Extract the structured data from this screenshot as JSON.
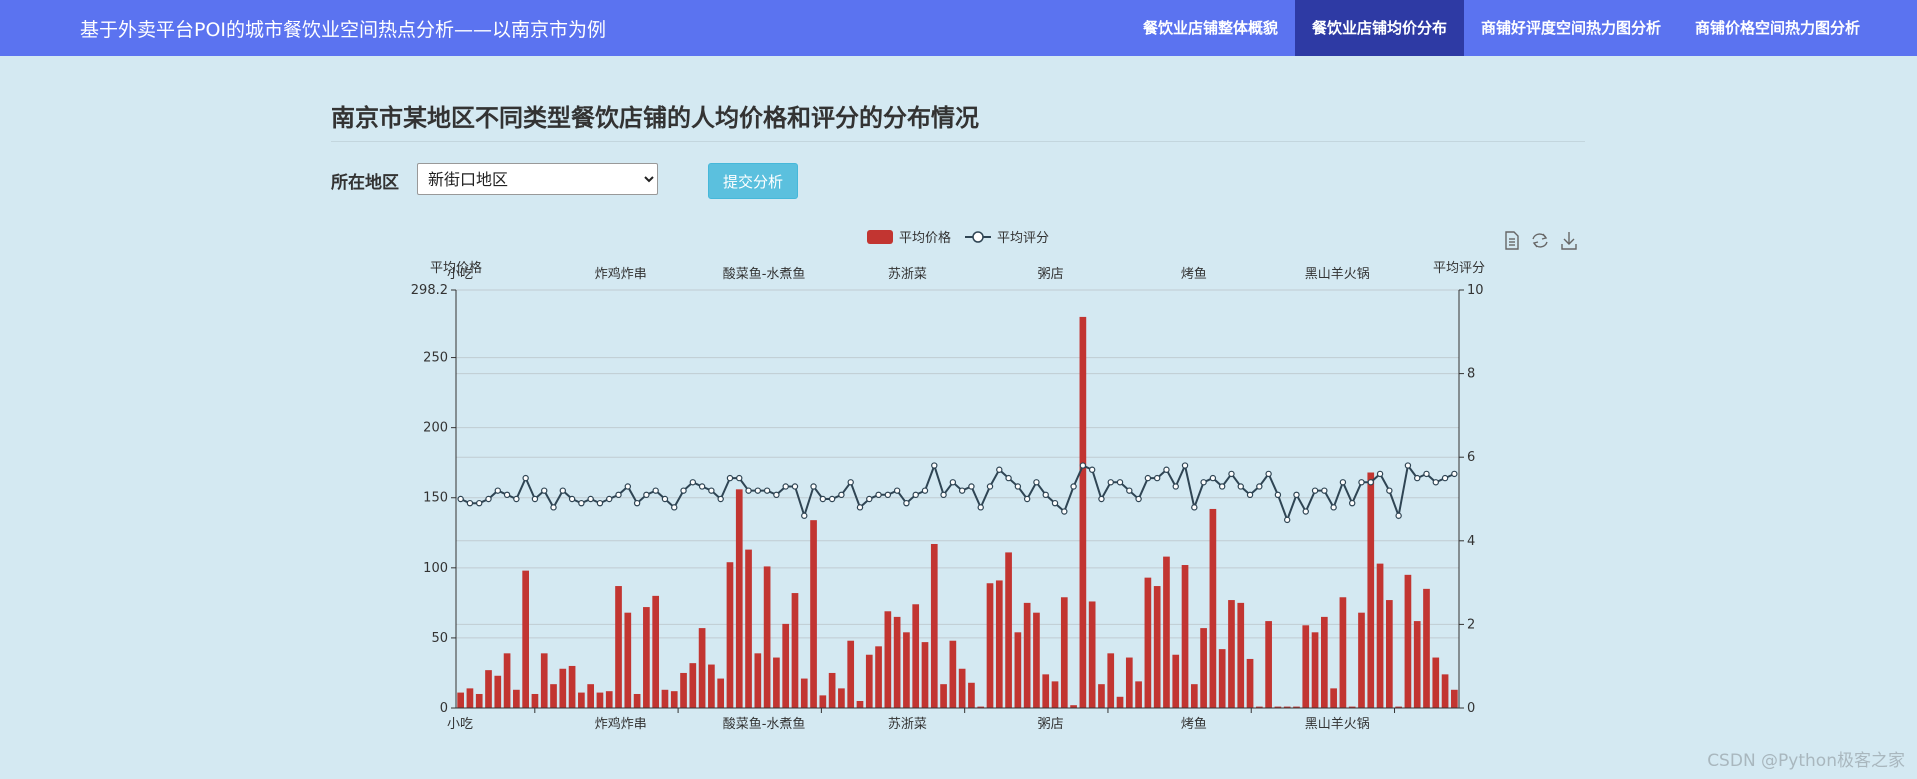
{
  "navbar": {
    "brand": "基于外卖平台POI的城市餐饮业空间热点分析——以南京市为例",
    "items": [
      {
        "label": "餐饮业店铺整体概貌",
        "active": false
      },
      {
        "label": "餐饮业店铺均价分布",
        "active": true
      },
      {
        "label": "商铺好评度空间热力图分析",
        "active": false
      },
      {
        "label": "商铺价格空间热力图分析",
        "active": false
      }
    ]
  },
  "page_title": "南京市某地区不同类型餐饮店铺的人均价格和评分的分布情况",
  "form": {
    "region_label": "所在地区",
    "region_value": "新街口地区",
    "submit_label": "提交分析"
  },
  "toolbox": [
    "data-view-icon",
    "restore-icon",
    "save-image-icon"
  ],
  "watermark": "CSDN @Python极客之家",
  "chart_data": {
    "type": "bar+line",
    "legend": [
      "平均价格",
      "平均评分"
    ],
    "legend_position": "top-center",
    "grid": true,
    "colors": {
      "bar": "#c23531",
      "line": "#2f4554"
    },
    "y_left": {
      "label": "平均价格",
      "min": 0,
      "max": 298.2,
      "ticks": [
        "0",
        "50",
        "100",
        "150",
        "200",
        "250",
        "298.2"
      ]
    },
    "y_right": {
      "label": "平均评分",
      "min": 0,
      "max": 10,
      "ticks": [
        "0",
        "2",
        "4",
        "6",
        "8",
        "10"
      ]
    },
    "x_tick_labels": [
      "小吃",
      "炸鸡炸串",
      "酸菜鱼-水煮鱼",
      "苏浙菜",
      "粥店",
      "烤鱼",
      "黑山羊火锅"
    ],
    "series": [
      {
        "name": "平均价格",
        "type": "bar",
        "values": [
          11,
          14,
          10,
          27,
          23,
          39,
          13,
          98,
          10,
          39,
          17,
          28,
          30,
          11,
          17,
          11,
          12,
          87,
          68,
          10,
          72,
          80,
          13,
          12,
          25,
          32,
          57,
          31,
          21,
          104,
          156,
          113,
          39,
          101,
          36,
          60,
          82,
          21,
          134,
          9,
          25,
          14,
          48,
          5,
          38,
          44,
          69,
          65,
          54,
          74,
          47,
          117,
          17,
          48,
          28,
          18,
          1,
          89,
          91,
          111,
          54,
          75,
          68,
          24,
          19,
          79,
          2,
          279,
          76,
          17,
          39,
          8,
          36,
          19,
          93,
          87,
          108,
          38,
          102,
          17,
          57,
          142,
          42,
          77,
          75,
          35,
          1,
          62,
          1,
          1,
          1,
          59,
          54,
          65,
          14,
          79,
          1,
          68,
          168,
          103,
          77,
          1,
          95,
          62,
          85,
          36,
          24,
          13
        ]
      },
      {
        "name": "平均评分",
        "type": "line",
        "values": [
          5.0,
          4.9,
          4.9,
          5.0,
          5.2,
          5.1,
          5.0,
          5.5,
          5.0,
          5.2,
          4.8,
          5.2,
          5.0,
          4.9,
          5.0,
          4.9,
          5.0,
          5.1,
          5.3,
          4.9,
          5.1,
          5.2,
          5.0,
          4.8,
          5.2,
          5.4,
          5.3,
          5.2,
          5.0,
          5.5,
          5.5,
          5.2,
          5.2,
          5.2,
          5.1,
          5.3,
          5.3,
          4.6,
          5.3,
          5.0,
          5.0,
          5.1,
          5.4,
          4.8,
          5.0,
          5.1,
          5.1,
          5.2,
          4.9,
          5.1,
          5.2,
          5.8,
          5.1,
          5.4,
          5.2,
          5.3,
          4.8,
          5.3,
          5.7,
          5.5,
          5.3,
          5.0,
          5.4,
          5.1,
          4.9,
          4.7,
          5.3,
          5.8,
          5.7,
          5.0,
          5.4,
          5.4,
          5.2,
          5.0,
          5.5,
          5.5,
          5.7,
          5.3,
          5.8,
          4.8,
          5.4,
          5.5,
          5.3,
          5.6,
          5.3,
          5.1,
          5.3,
          5.6,
          5.1,
          4.5,
          5.1,
          4.7,
          5.2,
          5.2,
          4.8,
          5.4,
          4.9,
          5.4,
          5.4,
          5.6,
          5.2,
          4.6,
          5.8,
          5.5,
          5.6,
          5.4,
          5.5,
          5.6
        ]
      }
    ]
  }
}
